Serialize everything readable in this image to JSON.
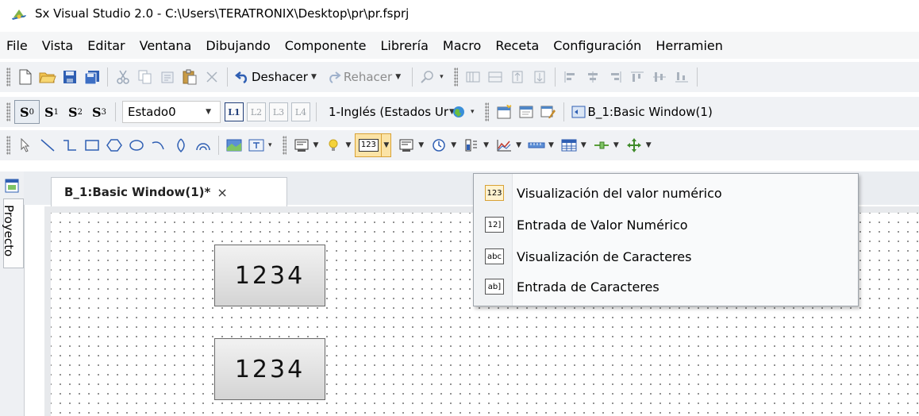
{
  "window": {
    "title": "Sx Visual Studio 2.0 - C:\\Users\\TERATRONIX\\Desktop\\pr\\pr.fsprj"
  },
  "menubar": {
    "items": [
      "File",
      "Vista",
      "Editar",
      "Ventana",
      "Dibujando",
      "Componente",
      "Librería",
      "Macro",
      "Receta",
      "Configuración",
      "Herramien"
    ]
  },
  "toolbar1": {
    "undo_label": "Deshacer",
    "redo_label": "Rehacer"
  },
  "toolbar2": {
    "states": [
      {
        "base": "S",
        "sub": "0"
      },
      {
        "base": "S",
        "sub": "1"
      },
      {
        "base": "S",
        "sub": "2"
      },
      {
        "base": "S",
        "sub": "3"
      }
    ],
    "state_combo": "Estado0",
    "layers": [
      "L1",
      "L2",
      "L3",
      "L4"
    ],
    "language_combo": "1-Inglés (Estados Ur",
    "window_label": "B_1:Basic Window(1)"
  },
  "toolbar3": {
    "numeric_button_label": "123"
  },
  "left_dock": {
    "project_label": "Proyecto"
  },
  "document": {
    "tab_label": "B_1:Basic Window(1)*",
    "close_glyph": "×"
  },
  "canvas": {
    "displays": [
      {
        "value": "1234"
      },
      {
        "value": "1234"
      }
    ]
  },
  "dropdown": {
    "items": [
      {
        "icon_text": "123",
        "label": "Visualización del valor numérico"
      },
      {
        "icon_text": "12]",
        "label": "Entrada de Valor Numérico"
      },
      {
        "icon_text": "abc",
        "label": "Visualización de Caracteres"
      },
      {
        "icon_text": "ab]",
        "label": "Entrada de Caracteres"
      }
    ]
  },
  "colors": {
    "accent": "#2f5fb3",
    "highlight": "#d8a236"
  }
}
